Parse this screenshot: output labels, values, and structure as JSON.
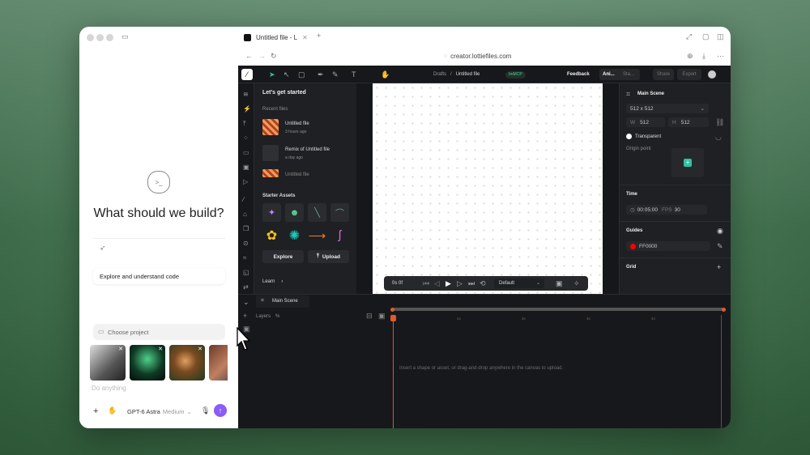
{
  "browser": {
    "tab_title": "Untitled file - L",
    "url": "creator.lottiefiles.com"
  },
  "chat": {
    "heading": "What should we build?",
    "explore_label": "Explore and understand code",
    "choose_project": "Choose project",
    "input_placeholder": "Do anything",
    "model_name": "GPT-6 Astra",
    "model_effort": "Medium"
  },
  "app": {
    "breadcrumb_root": "Drafts",
    "breadcrumb_sep": "/",
    "file_name": "Untitled file",
    "status_badge": "ImMCP",
    "feedback": "Feedback",
    "mode_anim": "Ani...",
    "mode_state": "Sta...",
    "share": "Share",
    "export": "Export",
    "left_panel": {
      "title": "Let's get started",
      "recent_label": "Recent files",
      "recent_files": [
        {
          "name": "Untitled file",
          "time": "3 hours ago"
        },
        {
          "name": "Remix of Untitled file",
          "time": "a day ago"
        },
        {
          "name": "Untitled file",
          "time": ""
        }
      ],
      "starter_label": "Starter Assets",
      "explore_btn": "Explore",
      "upload_btn": "Upload",
      "learn": "Learn"
    },
    "right_panel": {
      "scene_title": "Main Scene",
      "size_preset": "512 x 512",
      "w_label": "W",
      "w_value": "512",
      "h_label": "H",
      "h_value": "512",
      "background": "Transparent",
      "origin_label": "Origin point",
      "time_label": "Time",
      "duration": "00:05:00",
      "fps_label": "FPS",
      "fps_value": "30",
      "guides_label": "Guides",
      "guide_color": "FF0000",
      "grid_label": "Grid"
    },
    "player": {
      "time": "0s 0f",
      "segment": "Default"
    },
    "timeline": {
      "scene_tab": "Main Scene",
      "layers_label": "Layers",
      "layers_count": "%",
      "empty_msg": "Insert a shape or asset, or drag-and-drop anywhere in the canvas to upload.",
      "ticks": [
        "1s",
        "2s",
        "3s",
        "4s"
      ]
    }
  },
  "colors": {
    "accent": "#2ec4a0",
    "send_button": "#8b5cf6",
    "guide": "#ff0000",
    "playhead": "#e05a2b"
  }
}
